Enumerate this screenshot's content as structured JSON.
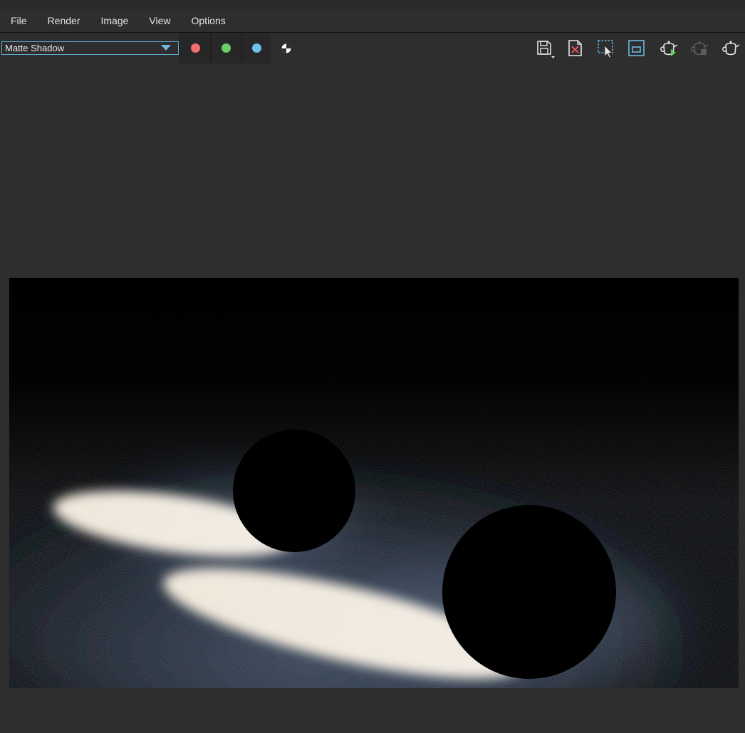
{
  "menu": {
    "items": [
      {
        "label": "File"
      },
      {
        "label": "Render"
      },
      {
        "label": "Image"
      },
      {
        "label": "View"
      },
      {
        "label": "Options"
      }
    ]
  },
  "toolbar": {
    "render_element": {
      "value": "Matte Shadow"
    },
    "channels": [
      {
        "name": "red-channel",
        "color": "#f26f6f"
      },
      {
        "name": "green-channel",
        "color": "#67d167"
      },
      {
        "name": "blue-channel",
        "color": "#6fc0ee"
      }
    ],
    "icons": [
      "save-image-icon",
      "clear-image-icon",
      "region-render-icon",
      "track-mouse-icon",
      "start-interactive-render-icon",
      "stop-render-icon",
      "render-icon"
    ],
    "accent_color": "#5ea9d6"
  }
}
